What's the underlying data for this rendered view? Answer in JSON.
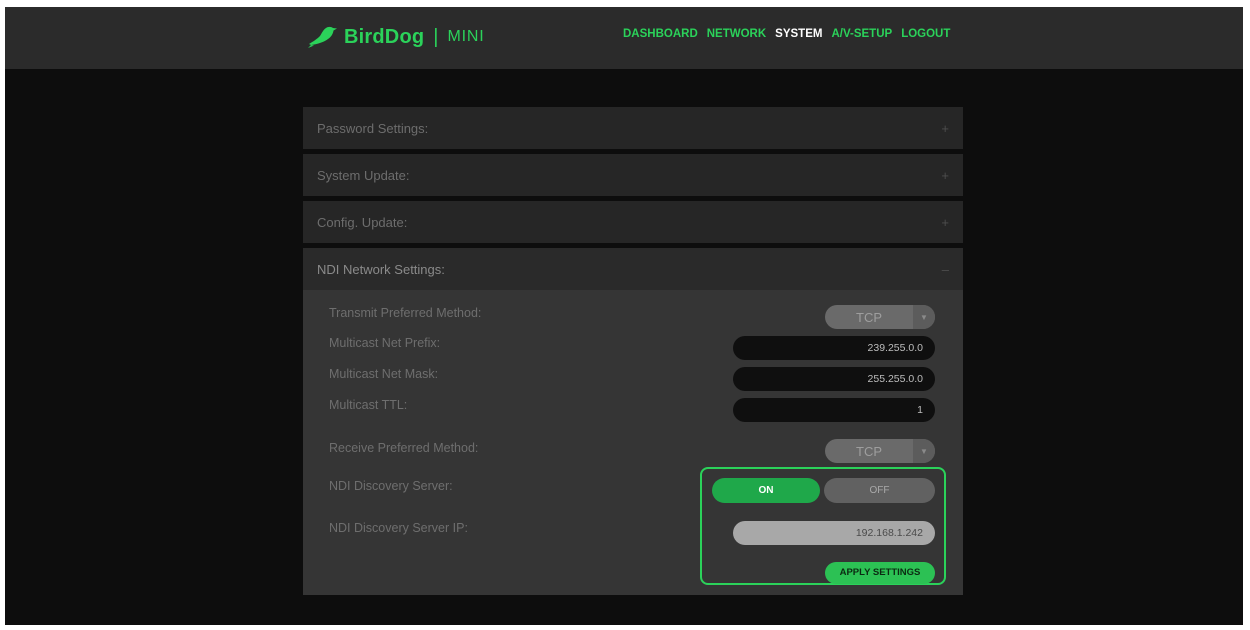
{
  "header": {
    "brand": "BirdDog",
    "separator": "|",
    "model": "MINI"
  },
  "nav": {
    "items": [
      {
        "label": "DASHBOARD",
        "active": false
      },
      {
        "label": "NETWORK",
        "active": false
      },
      {
        "label": "SYSTEM",
        "active": true
      },
      {
        "label": "A/V-SETUP",
        "active": false
      },
      {
        "label": "LOGOUT",
        "active": false
      }
    ]
  },
  "sections": {
    "password": {
      "title": "Password Settings:",
      "toggle": "+"
    },
    "system_update": {
      "title": "System Update:",
      "toggle": "+"
    },
    "config_update": {
      "title": "Config. Update:",
      "toggle": "+"
    },
    "ndi": {
      "title": "NDI Network Settings:",
      "toggle": "–"
    }
  },
  "ndi": {
    "transmit_method": {
      "label": "Transmit Preferred Method:",
      "value": "TCP"
    },
    "multicast_prefix": {
      "label": "Multicast Net Prefix:",
      "value": "239.255.0.0"
    },
    "multicast_mask": {
      "label": "Multicast Net Mask:",
      "value": "255.255.0.0"
    },
    "multicast_ttl": {
      "label": "Multicast TTL:",
      "value": "1"
    },
    "receive_method": {
      "label": "Receive Preferred Method:",
      "value": "TCP"
    },
    "discovery_server": {
      "label": "NDI Discovery Server:",
      "on_label": "ON",
      "off_label": "OFF",
      "state": "ON"
    },
    "discovery_ip": {
      "label": "NDI Discovery Server IP:",
      "value": "192.168.1.242"
    },
    "apply_label": "APPLY SETTINGS",
    "arrow_glyph": "▼"
  },
  "colors": {
    "accent": "#2bd25a",
    "highlight_border": "#2bd25a",
    "on_button": "#1fa84a"
  }
}
